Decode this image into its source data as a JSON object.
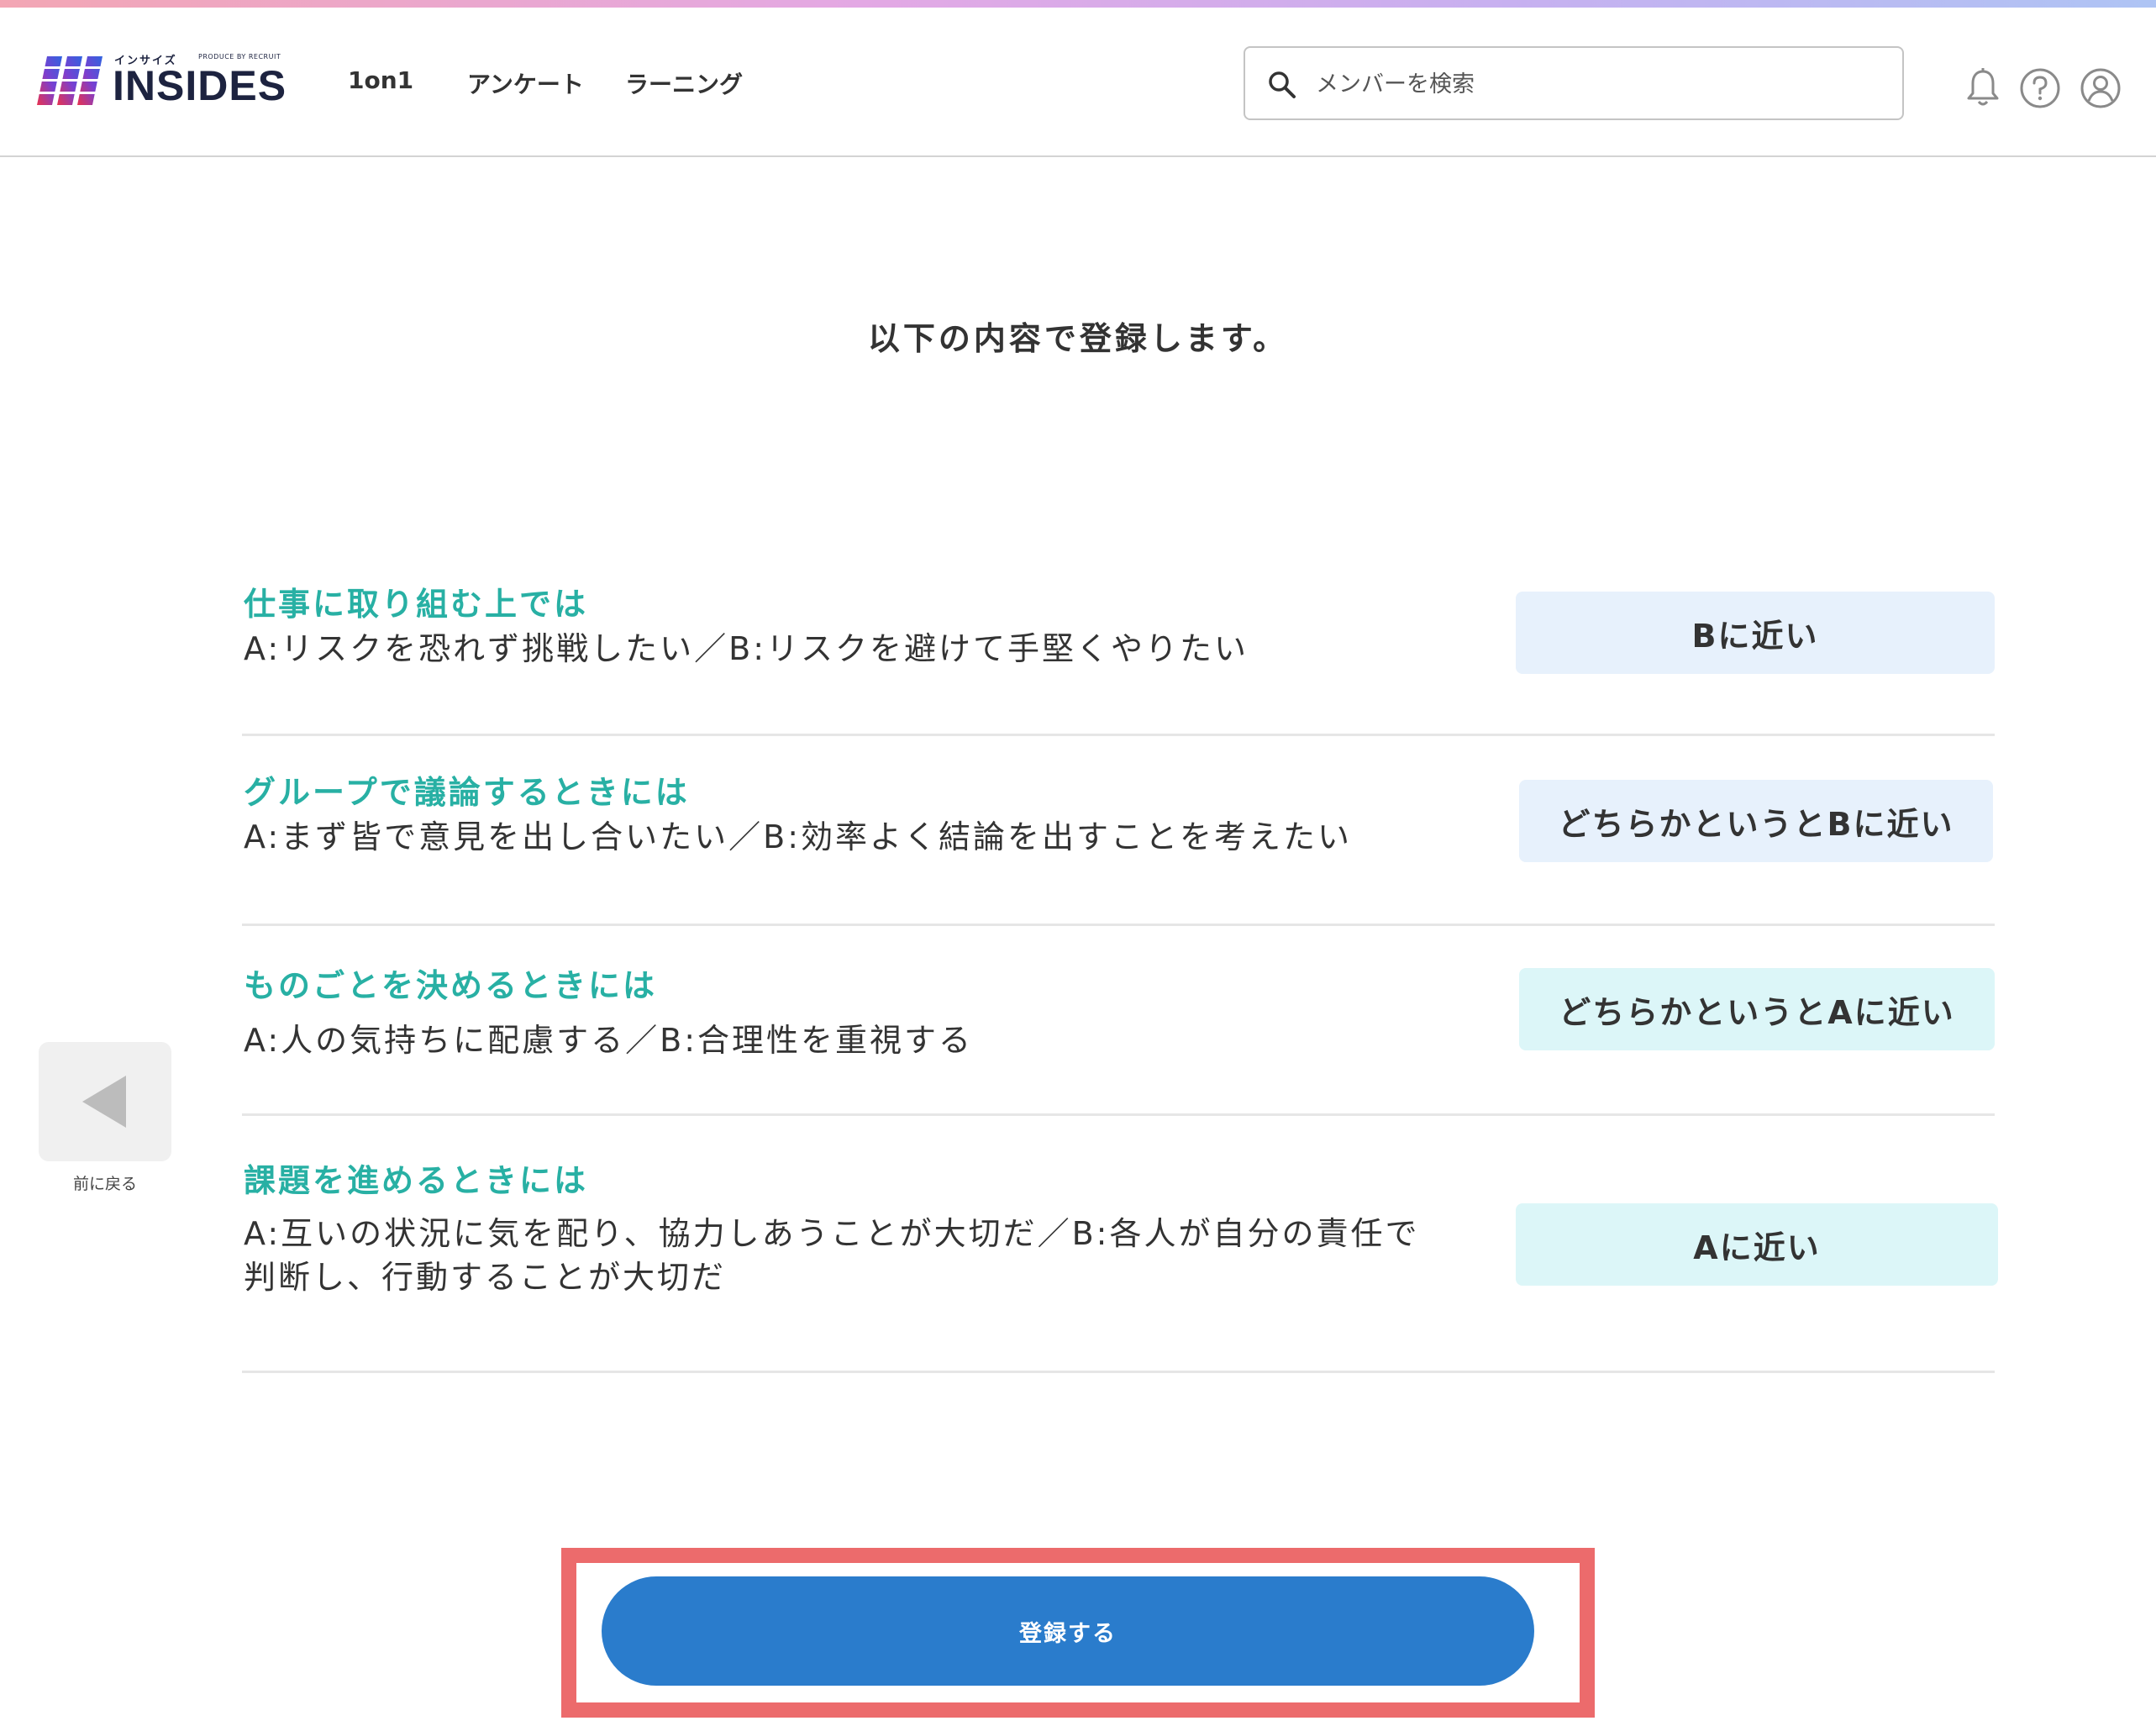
{
  "header": {
    "logo_kana": "インサイズ",
    "logo_produce": "PRODUCE BY RECRUIT",
    "logo_text": "INSIDES",
    "nav": [
      "1on1",
      "アンケート",
      "ラーニング"
    ],
    "search_placeholder": "メンバーを検索",
    "icons": [
      "bell-icon",
      "help-icon",
      "account-icon"
    ]
  },
  "page": {
    "title": "以下の内容で登録します。"
  },
  "items": [
    {
      "title": "仕事に取り組む上では",
      "desc": "A:リスクを恐れず挑戦したい／B:リスクを避けて手堅くやりたい",
      "answer": "Bに近い"
    },
    {
      "title": "グループで議論するときには",
      "desc": "A:まず皆で意見を出し合いたい／B:効率よく結論を出すことを考えたい",
      "answer": "どちらかというとBに近い"
    },
    {
      "title": "ものごとを決めるときには",
      "desc": "A:人の気持ちに配慮する／B:合理性を重視する",
      "answer": "どちらかというとAに近い"
    },
    {
      "title": "課題を進めるときには",
      "desc": "A:互いの状況に気を配り、協力しあうことが大切だ／B:各人が自分の責任で判断し、行動することが大切だ",
      "answer": "Aに近い"
    }
  ],
  "back": {
    "label": "前に戻る"
  },
  "submit": {
    "label": "登録する"
  },
  "colors": {
    "accent_teal": "#28b0a4",
    "primary_blue": "#2a7ccc",
    "answer_b_bg": "#e7f1fc",
    "answer_a_bg": "#dcf6f8",
    "highlight": "#ec6b6c"
  }
}
